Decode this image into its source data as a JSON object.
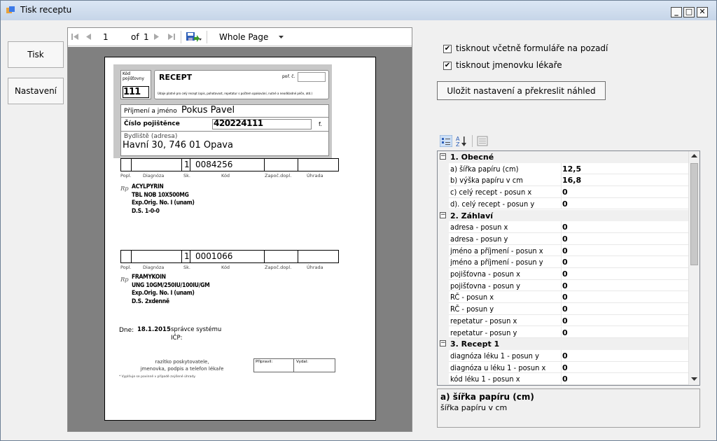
{
  "window": {
    "title": "Tisk receptu"
  },
  "left_buttons": {
    "print": "Tisk",
    "settings": "Nastavení"
  },
  "viewer": {
    "page_current": "1",
    "page_of": "of",
    "page_total": "1",
    "zoom": "Whole Page"
  },
  "prescription": {
    "insurer_label": "Kód pojišťovny",
    "insurer_code": "111",
    "title": "RECEPT",
    "order_label": "poř. č.",
    "note": "Údaje platné pro celý recept (opis, pohotovost, repetatur s počtem opakování, nutné a neodkladné péče, atd.)",
    "name_label": "Příjmení a jméno",
    "name_value": "Pokus Pavel",
    "insured_label": "Číslo pojištěnce",
    "insured_value": "420224111",
    "f_label": "f.",
    "address_label": "Bydliště (adresa)",
    "address_value": "Havní 30, 746 01 Opava",
    "col_labels": [
      "Popl.",
      "Diagnóza",
      "Sk.",
      "Kód",
      "Započ.dopl.",
      "Úhrada"
    ],
    "rp": "Rp",
    "items": [
      {
        "sk": "1",
        "code": "0084256",
        "lines": [
          "ACYLPYRIN",
          "TBL NOB 10X500MG",
          "Exp.Orig. No. I (unam)",
          "D.S. 1-0-0"
        ]
      },
      {
        "sk": "1",
        "code": "0001066",
        "lines": [
          "FRAMYKOIN",
          "UNG 10GM/250IU/100IU/GM",
          "Exp.Orig. No. I (unam)",
          "D.S. 2xdenně"
        ]
      }
    ],
    "date_label": "Dne:",
    "date_value": "18.1.2015",
    "issuer_line1": "správce systému",
    "issuer_line2": "IČP:",
    "stamp_line1": "razítko poskytovatele,",
    "stamp_line2": "jmenovka, podpis a telefon lékaře",
    "prepared_label": "Připravil:",
    "issued_label": "Vydal:",
    "footnote": "* Vyplňuje se povinně v případě zvýšené úhrady."
  },
  "options": {
    "check1": {
      "label": "tisknout včetně formuláře na pozadí",
      "checked": "✔"
    },
    "check2": {
      "label": "tisknout jmenovku lékaře",
      "checked": "✔"
    },
    "save_button": "Uložit nastavení a překreslit náhled"
  },
  "grid_rows": [
    {
      "cat": true,
      "name": "1. Obecné",
      "value": ""
    },
    {
      "name": "a) šířka papíru (cm)",
      "value": "12,5"
    },
    {
      "name": "b) výška papíru v cm",
      "value": "16,8"
    },
    {
      "name": "c) celý recept - posun x",
      "value": "0"
    },
    {
      "name": "d). celý recept - posun y",
      "value": "0"
    },
    {
      "cat": true,
      "name": "2. Záhlaví",
      "value": ""
    },
    {
      "name": "adresa - posun x",
      "value": "0"
    },
    {
      "name": "adresa - posun y",
      "value": "0"
    },
    {
      "name": "jméno a příjmení - posun x",
      "value": "0"
    },
    {
      "name": "jméno a příjmení - posun y",
      "value": "0"
    },
    {
      "name": "pojišťovna - posun x",
      "value": "0"
    },
    {
      "name": "pojišťovna - posun y",
      "value": "0"
    },
    {
      "name": "RČ - posun x",
      "value": "0"
    },
    {
      "name": "RČ - posun y",
      "value": "0"
    },
    {
      "name": "repetatur - posun x",
      "value": "0"
    },
    {
      "name": "repetatur - posun y",
      "value": "0"
    },
    {
      "cat": true,
      "name": "3. Recept 1",
      "value": ""
    },
    {
      "name": "diagnóza léku 1 - posun y",
      "value": "0"
    },
    {
      "name": "diagnóza u léku 1 - posun x",
      "value": "0"
    },
    {
      "name": "kód léku 1 - posun x",
      "value": "0"
    }
  ],
  "description": {
    "title": "a) šířka papíru (cm)",
    "text": "šířka papíru v cm"
  }
}
